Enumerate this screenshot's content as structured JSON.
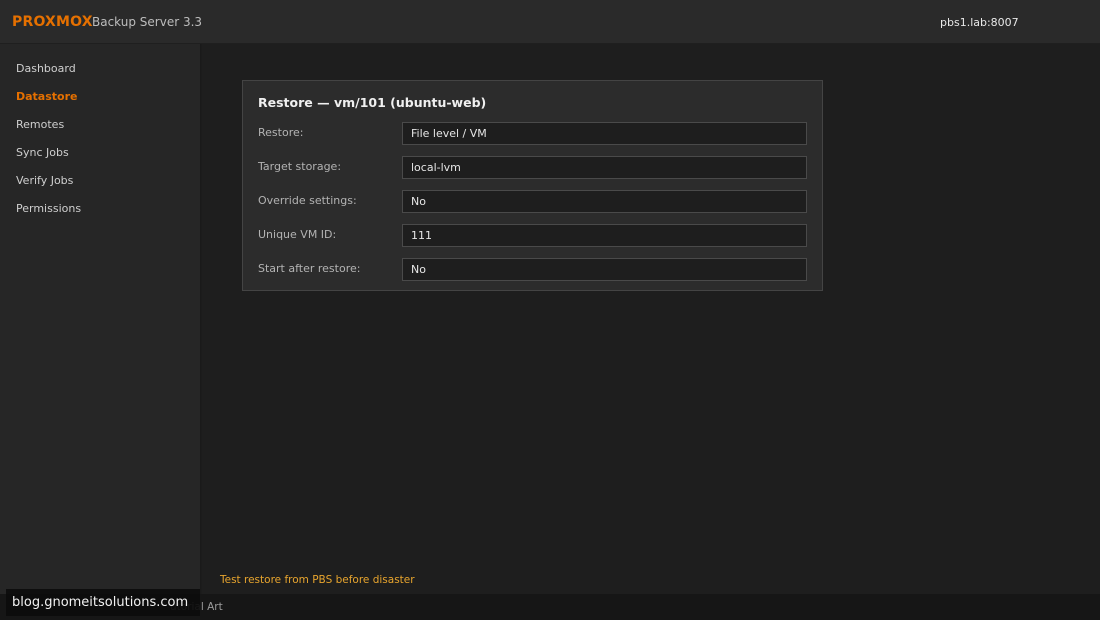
{
  "header": {
    "logo": "PROXMOX",
    "product": "Backup Server 3.3",
    "hostname": "pbs1.lab:8007",
    "brand_color": "#e57000"
  },
  "sidebar": {
    "items": [
      {
        "label": "Dashboard",
        "active": false
      },
      {
        "label": "Datastore",
        "active": true
      },
      {
        "label": "Remotes",
        "active": false
      },
      {
        "label": "Sync Jobs",
        "active": false
      },
      {
        "label": "Verify Jobs",
        "active": false
      },
      {
        "label": "Permissions",
        "active": false
      }
    ]
  },
  "dialog": {
    "title": "Restore — vm/101 (ubuntu-web)",
    "fields": [
      {
        "label": "Restore:",
        "value": "File level / VM"
      },
      {
        "label": "Target storage:",
        "value": "local-lvm"
      },
      {
        "label": "Override settings:",
        "value": "No"
      },
      {
        "label": "Unique VM ID:",
        "value": "111"
      },
      {
        "label": "Start after restore:",
        "value": "No"
      }
    ]
  },
  "tip": "Test restore from PBS before disaster",
  "footer": {
    "text": "utorial Art"
  },
  "watermark": "blog.gnomeitsolutions.com"
}
